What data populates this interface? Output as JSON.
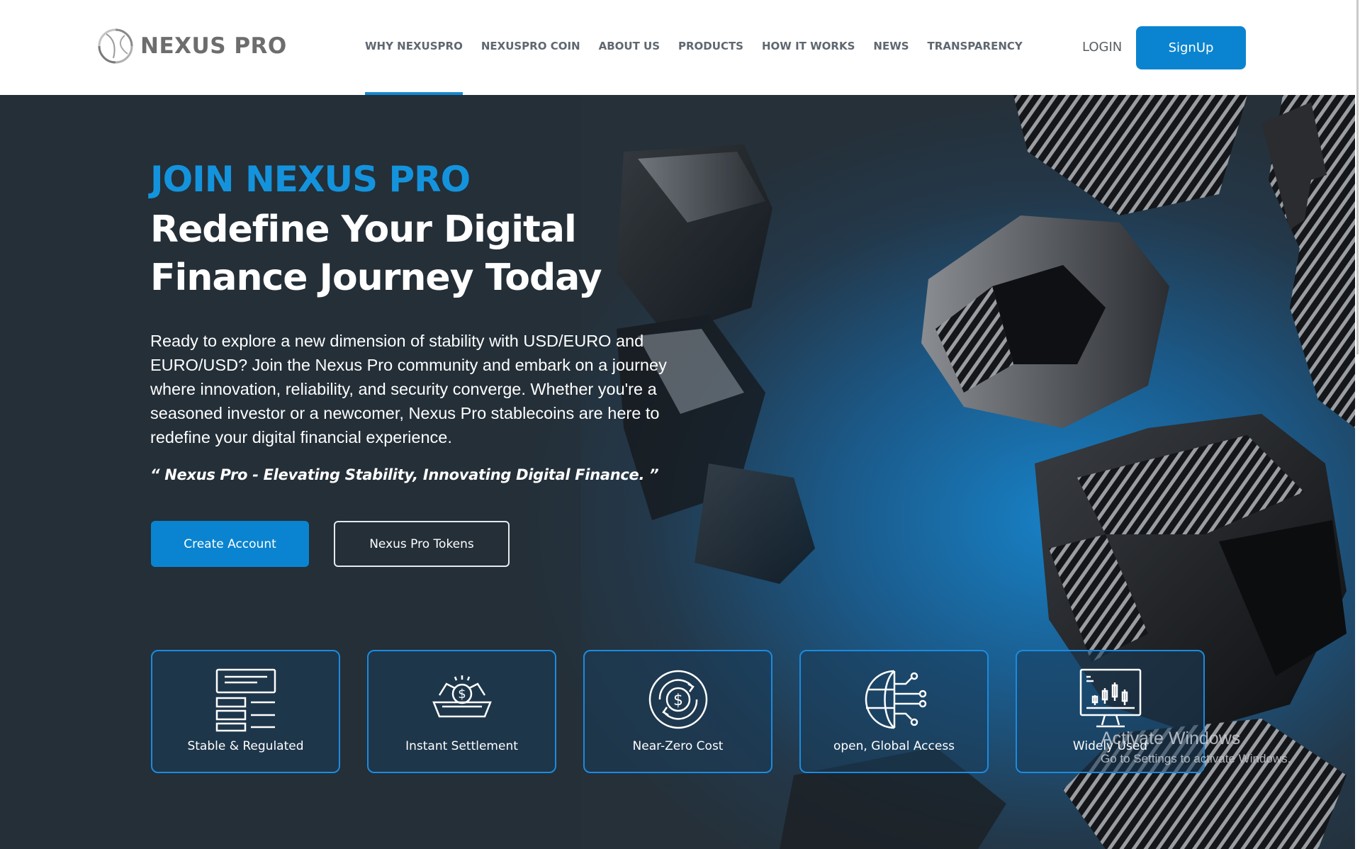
{
  "brand": {
    "name": "NEXUS PRO",
    "logo_icon": "swirl-logo-icon"
  },
  "nav": {
    "items": [
      {
        "label": "WHY NEXUSPRO",
        "active": true
      },
      {
        "label": "NEXUSPRO COIN",
        "active": false
      },
      {
        "label": "ABOUT US",
        "active": false
      },
      {
        "label": "PRODUCTS",
        "active": false
      },
      {
        "label": "HOW IT WORKS",
        "active": false
      },
      {
        "label": "NEWS",
        "active": false
      },
      {
        "label": "TRANSPARENCY",
        "active": false
      }
    ],
    "login_label": "LOGIN",
    "signup_label": "SignUp"
  },
  "hero": {
    "eyebrow": "JOIN NEXUS PRO",
    "headline_line1": "Redefine Your Digital",
    "headline_line2": "Finance Journey Today",
    "description": "Ready to explore a new dimension of stability with USD/EURO and EURO/USD? Join the Nexus Pro community and embark on a journey where innovation, reliability, and security converge. Whether you're a seasoned investor or a newcomer, Nexus Pro stablecoins are here to redefine your digital financial experience.",
    "quote": "“ Nexus Pro - Elevating Stability, Innovating Digital Finance. ”",
    "primary_button": "Create Account",
    "secondary_button": "Nexus Pro Tokens"
  },
  "features": [
    {
      "label": "Stable & Regulated",
      "icon": "document-list-icon"
    },
    {
      "label": "Instant Settlement",
      "icon": "money-box-icon"
    },
    {
      "label": "Near-Zero Cost",
      "icon": "dollar-coin-icon"
    },
    {
      "label": "open, Global Access",
      "icon": "globe-network-icon"
    },
    {
      "label": "Widely Used",
      "icon": "chart-monitor-icon"
    }
  ],
  "os_watermark": {
    "title": "Activate Windows",
    "subtitle": "Go to Settings to activate Windows."
  },
  "colors": {
    "accent": "#0a84d0",
    "eyebrow": "#1493dd",
    "hero_bg": "#253039",
    "nav_text": "#5f6770",
    "card_border": "#1a8be0"
  }
}
